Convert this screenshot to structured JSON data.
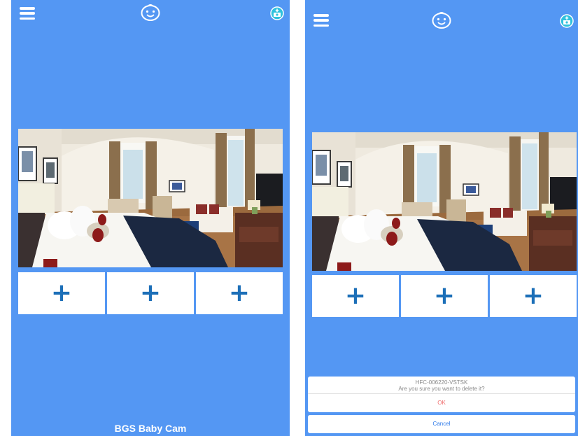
{
  "screens": {
    "left": {
      "menu_icon": "hamburger-menu-icon",
      "logo_icon": "baby-face-icon",
      "action_icon": "camera-add-icon",
      "preview_image": "hotel-bedroom-camera-preview",
      "slots": [
        {
          "label": "+",
          "icon": "plus-icon"
        },
        {
          "label": "+",
          "icon": "plus-icon"
        },
        {
          "label": "+",
          "icon": "plus-icon"
        }
      ],
      "app_name": "BGS Baby Cam"
    },
    "right": {
      "menu_icon": "hamburger-menu-icon",
      "logo_icon": "baby-face-icon",
      "action_icon": "camera-add-icon",
      "preview_image": "hotel-bedroom-camera-preview",
      "slots": [
        {
          "label": "+",
          "icon": "plus-icon"
        },
        {
          "label": "+",
          "icon": "plus-icon"
        },
        {
          "label": "+",
          "icon": "plus-icon"
        }
      ],
      "dialog": {
        "title": "HFC-006220-VSTSK",
        "message": "Are you sure you want to delete it?",
        "ok_label": "OK",
        "cancel_label": "Cancel"
      }
    }
  },
  "colors": {
    "background": "#5497f3",
    "plus": "#1c6fb8",
    "ok_text": "#f06e6e",
    "cancel_text": "#2f7bea",
    "camera_icon": "#2fc1dd"
  }
}
